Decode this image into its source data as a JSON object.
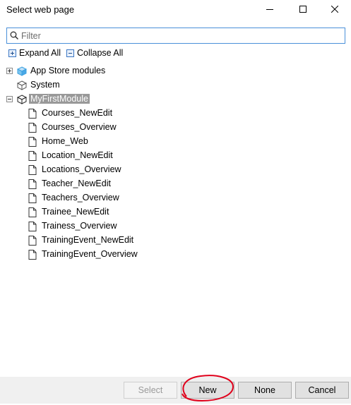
{
  "window": {
    "title": "Select web page",
    "minimize_icon": "minimize-icon",
    "maximize_icon": "maximize-icon",
    "close_icon": "close-icon"
  },
  "filter": {
    "placeholder": "Filter",
    "value": ""
  },
  "toolbar": {
    "expand_all": "Expand All",
    "collapse_all": "Collapse All"
  },
  "tree": {
    "roots": [
      {
        "label": "App Store modules",
        "expander": "plus",
        "icon": "module-box-icon-blue"
      },
      {
        "label": "System",
        "expander": "none",
        "icon": "module-box-icon-gray"
      },
      {
        "label": "MyFirstModule",
        "expander": "minus",
        "icon": "module-box-icon-dark",
        "selected": true
      }
    ],
    "pages": [
      "Courses_NewEdit",
      "Courses_Overview",
      "Home_Web",
      "Location_NewEdit",
      "Locations_Overview",
      "Teacher_NewEdit",
      "Teachers_Overview",
      "Trainee_NewEdit",
      "Trainess_Overview",
      "TrainingEvent_NewEdit",
      "TrainingEvent_Overview"
    ]
  },
  "buttons": {
    "select": "Select",
    "new": "New",
    "none": "None",
    "cancel": "Cancel"
  },
  "colors": {
    "accent": "#4a90d9",
    "selected_bg": "#999999",
    "annotation": "#e0001b"
  }
}
